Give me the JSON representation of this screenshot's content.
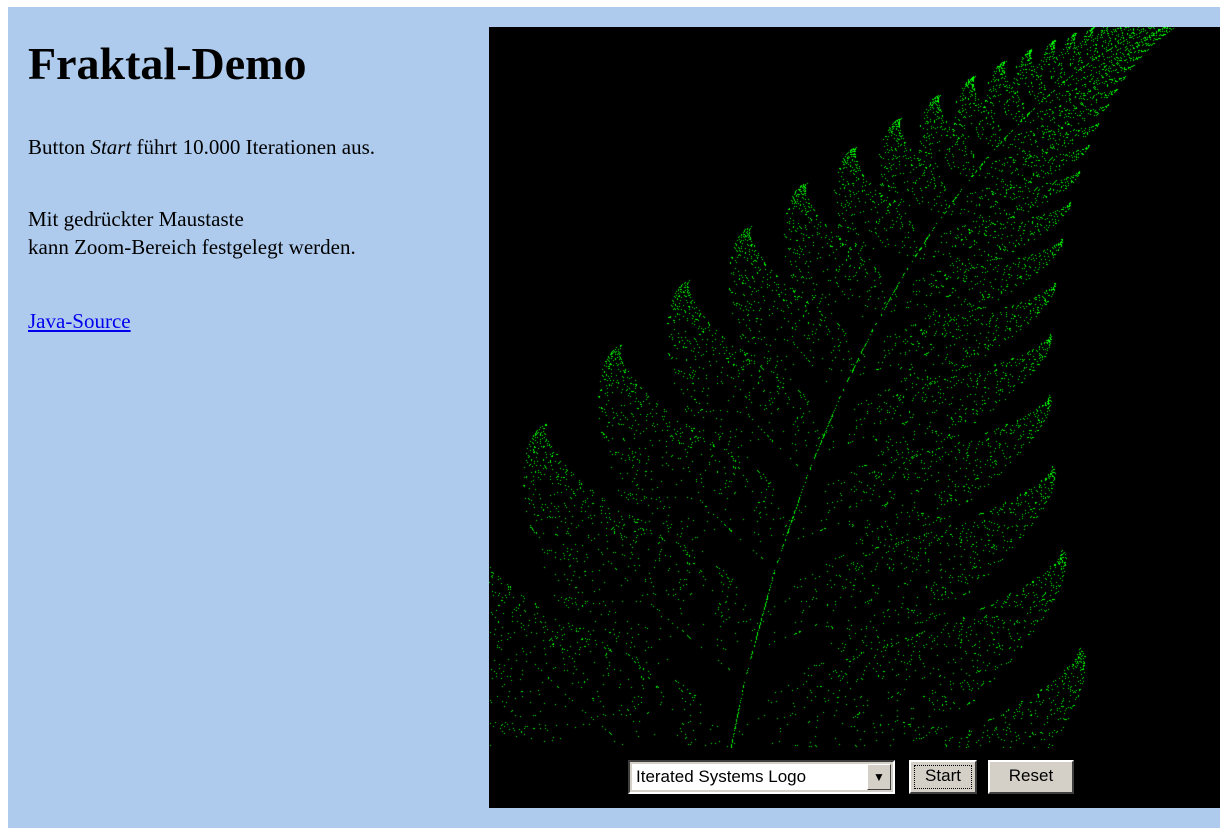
{
  "title": "Fraktal-Demo",
  "intro": {
    "prefix": "Button ",
    "italic": "Start",
    "suffix": " führt 10.000 Iterationen aus."
  },
  "zoom_hint": {
    "line1": "Mit gedrückter Maustaste",
    "line2": "kann Zoom-Bereich festgelegt werden."
  },
  "source_link": "Java-Source",
  "applet": {
    "fractal_select_value": "Iterated Systems Logo",
    "start_label": "Start",
    "reset_label": "Reset",
    "fractal_color": "#00ff00",
    "background_color": "#000000",
    "dropdown_icon": "triangle-down-icon"
  },
  "colors": {
    "page_background": "#aecbed",
    "link": "#0000ee"
  }
}
